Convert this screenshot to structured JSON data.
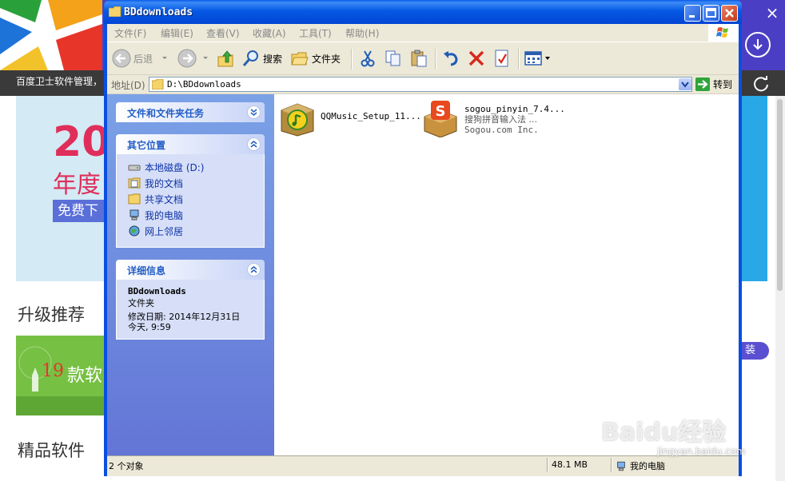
{
  "background_app": {
    "title": "百度卫士软件管理，",
    "banner_big": "20",
    "banner_sub": "年度",
    "banner_button": "免费下",
    "section_upgrade": "升级推荐",
    "promo_number": "19",
    "promo_text": "款软",
    "install_button": "装",
    "section_quality": "精品软件"
  },
  "window": {
    "title": "BDdownloads",
    "menu": [
      "文件(F)",
      "编辑(E)",
      "查看(V)",
      "收藏(A)",
      "工具(T)",
      "帮助(H)"
    ],
    "toolbar": {
      "back_label": "后退",
      "search_label": "搜索",
      "folders_label": "文件夹"
    },
    "address": {
      "label": "地址(D)",
      "value": "D:\\BDdownloads",
      "go_label": "转到"
    }
  },
  "taskpane": {
    "tasks_title": "文件和文件夹任务",
    "other_title": "其它位置",
    "places": [
      {
        "label": "本地磁盘 (D:)",
        "icon": "drive-icon"
      },
      {
        "label": "我的文档",
        "icon": "my-documents-icon"
      },
      {
        "label": "共享文档",
        "icon": "shared-documents-icon"
      },
      {
        "label": "我的电脑",
        "icon": "my-computer-icon"
      },
      {
        "label": "网上邻居",
        "icon": "network-places-icon"
      }
    ],
    "details_title": "详细信息",
    "details": {
      "name": "BDdownloads",
      "type": "文件夹",
      "modified": "修改日期: 2014年12月31日",
      "time": "今天, 9:59"
    }
  },
  "files": [
    {
      "name": "QQMusic_Setup_11...",
      "icon": "qqmusic-installer-icon"
    },
    {
      "name": "sogou_pinyin_7.4...",
      "description": "搜狗拼音输入法 ...",
      "company": "Sogou.com Inc.",
      "icon": "sogou-installer-icon"
    }
  ],
  "statusbar": {
    "count": "2 个对象",
    "size": "48.1 MB",
    "location": "我的电脑"
  },
  "watermark": {
    "text": "Baidu经验",
    "url": "jingyan.baidu.com"
  }
}
